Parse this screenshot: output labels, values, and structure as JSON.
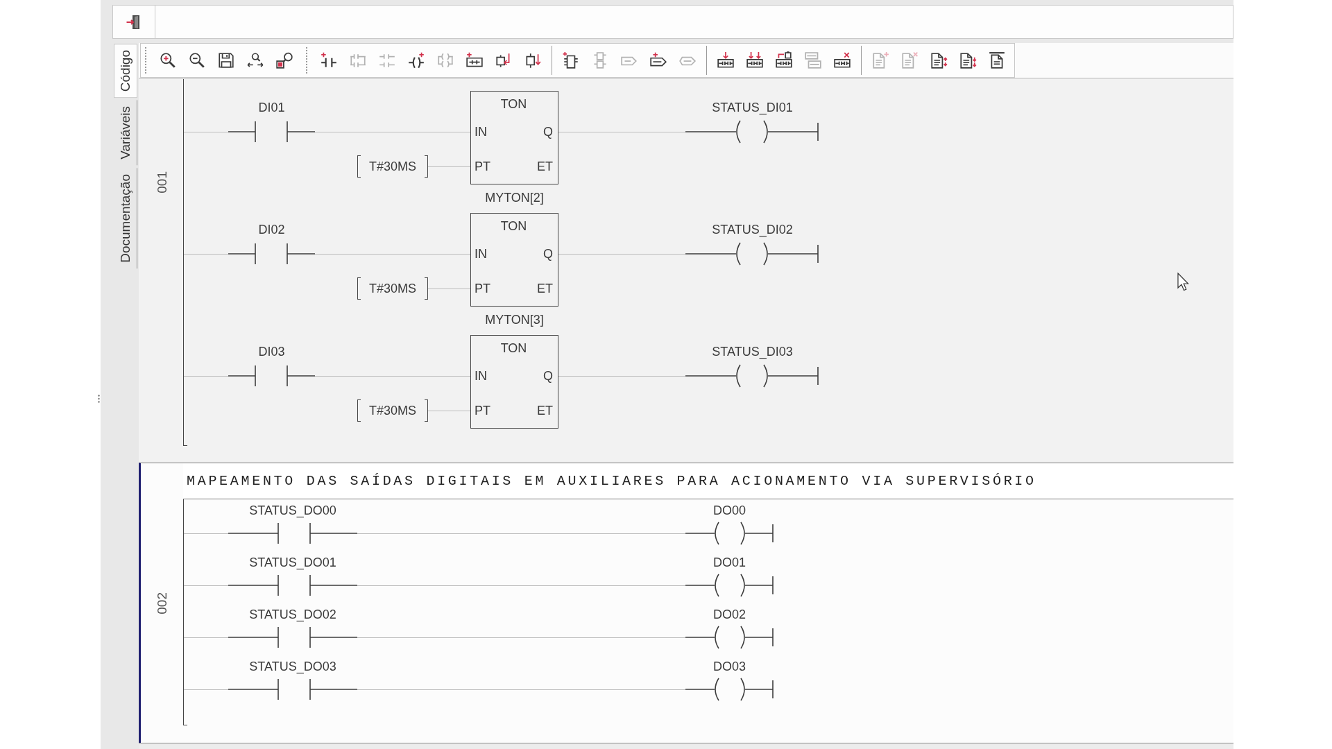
{
  "side_tabs": [
    {
      "label": "Código",
      "selected": true
    },
    {
      "label": "Variáveis",
      "selected": false
    },
    {
      "label": "Documentação",
      "selected": false
    }
  ],
  "toolbar": {
    "groups": [
      {
        "buttons": [
          {
            "disabled": false
          },
          {
            "disabled": false
          },
          {
            "disabled": false
          },
          {
            "disabled": false
          },
          {
            "disabled": false
          }
        ]
      },
      {
        "buttons": [
          {
            "disabled": false
          },
          {
            "disabled": true
          },
          {
            "disabled": true
          },
          {
            "disabled": false
          },
          {
            "disabled": true
          },
          {
            "disabled": false
          },
          {
            "disabled": false
          },
          {
            "disabled": false
          }
        ]
      },
      {
        "buttons": [
          {
            "disabled": false
          },
          {
            "disabled": true
          },
          {
            "disabled": true
          },
          {
            "disabled": false
          },
          {
            "disabled": true
          }
        ]
      },
      {
        "buttons": [
          {
            "disabled": false
          },
          {
            "disabled": false
          },
          {
            "disabled": false
          },
          {
            "disabled": true
          },
          {
            "disabled": false
          }
        ]
      },
      {
        "buttons": [
          {
            "disabled": true
          },
          {
            "disabled": true
          },
          {
            "disabled": false
          },
          {
            "disabled": false
          },
          {
            "disabled": false
          }
        ]
      }
    ]
  },
  "rungs": [
    {
      "number": "001",
      "kind": "timer",
      "selected": false,
      "rows": [
        {
          "contact": "DI01",
          "block": {
            "type": "TON",
            "inputs": [
              "IN",
              "PT"
            ],
            "outputs": [
              "Q",
              "ET"
            ]
          },
          "preset": "T#30MS",
          "coil": "STATUS_DI01"
        },
        {
          "contact": "DI02",
          "instance": "MYTON[2]",
          "block": {
            "type": "TON",
            "inputs": [
              "IN",
              "PT"
            ],
            "outputs": [
              "Q",
              "ET"
            ]
          },
          "preset": "T#30MS",
          "coil": "STATUS_DI02"
        },
        {
          "contact": "DI03",
          "instance": "MYTON[3]",
          "block": {
            "type": "TON",
            "inputs": [
              "IN",
              "PT"
            ],
            "outputs": [
              "Q",
              "ET"
            ]
          },
          "preset": "T#30MS",
          "coil": "STATUS_DI03"
        }
      ]
    },
    {
      "number": "002",
      "kind": "direct",
      "selected": true,
      "comment": "MAPEAMENTO DAS SAÍDAS DIGITAIS EM AUXILIARES PARA ACIONAMENTO VIA SUPERVISÓRIO",
      "rows": [
        {
          "contact": "STATUS_DO00",
          "coil": "DO00"
        },
        {
          "contact": "STATUS_DO01",
          "coil": "DO01"
        },
        {
          "contact": "STATUS_DO02",
          "coil": "DO02"
        },
        {
          "contact": "STATUS_DO03",
          "coil": "DO03"
        }
      ]
    }
  ]
}
